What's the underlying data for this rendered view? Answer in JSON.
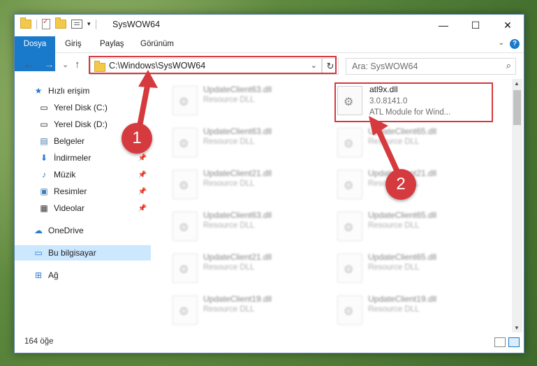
{
  "window": {
    "title": "SysWOW64",
    "minimize_glyph": "—",
    "maximize_glyph": "☐",
    "close_glyph": "✕"
  },
  "ribbon": {
    "tabs": [
      "Dosya",
      "Giriş",
      "Paylaş",
      "Görünüm"
    ],
    "help_label": "?"
  },
  "nav": {
    "back_glyph": "←",
    "forward_glyph": "→",
    "recent_glyph": "⌄",
    "up_glyph": "↑",
    "path": "C:\\Windows\\SysWOW64",
    "refresh_glyph": "↻",
    "search_placeholder": "Ara: SysWOW64"
  },
  "sidebar": {
    "items": [
      {
        "label": "Hızlı erişim",
        "icon": "star-icon"
      },
      {
        "label": "Yerel Disk (C:)",
        "icon": "drive-icon"
      },
      {
        "label": "Yerel Disk (D:)",
        "icon": "drive-icon"
      },
      {
        "label": "Belgeler",
        "icon": "document-icon"
      },
      {
        "label": "İndirmeler",
        "icon": "download-icon"
      },
      {
        "label": "Müzik",
        "icon": "music-icon"
      },
      {
        "label": "Resimler",
        "icon": "pictures-icon"
      },
      {
        "label": "Videolar",
        "icon": "video-icon"
      },
      {
        "label": "OneDrive",
        "icon": "cloud-icon"
      },
      {
        "label": "Bu bilgisayar",
        "icon": "computer-icon"
      },
      {
        "label": "Ağ",
        "icon": "network-icon"
      }
    ]
  },
  "files": {
    "highlighted": {
      "name": "atl9x.dll",
      "version": "3.0.8141.0",
      "description": "ATL Module for Wind..."
    },
    "left_column": [
      {
        "name": "UpdateClient63.dll",
        "type": "Resource DLL"
      },
      {
        "name": "UpdateClient63.dll",
        "type": "Resource DLL"
      },
      {
        "name": "UpdateClient21.dll",
        "type": "Resource DLL"
      },
      {
        "name": "UpdateClient63.dll",
        "type": "Resource DLL"
      },
      {
        "name": "UpdateClient21.dll",
        "type": "Resource DLL"
      },
      {
        "name": "UpdateClient19.dll",
        "type": "Resource DLL"
      }
    ],
    "right_column": [
      {
        "name": "UpdateClient65.dll",
        "type": "Resource DLL"
      },
      {
        "name": "UpdateClient21.dll",
        "type": "Resource DLL"
      },
      {
        "name": "UpdateClient65.dll",
        "type": "Resource DLL"
      },
      {
        "name": "UpdateClient65.dll",
        "type": "Resource DLL"
      },
      {
        "name": "UpdateClient19.dll",
        "type": "Resource DLL"
      }
    ]
  },
  "status": {
    "item_count": "164 öğe"
  },
  "annotations": {
    "step1": "1",
    "step2": "2",
    "color": "#d53a3f"
  }
}
